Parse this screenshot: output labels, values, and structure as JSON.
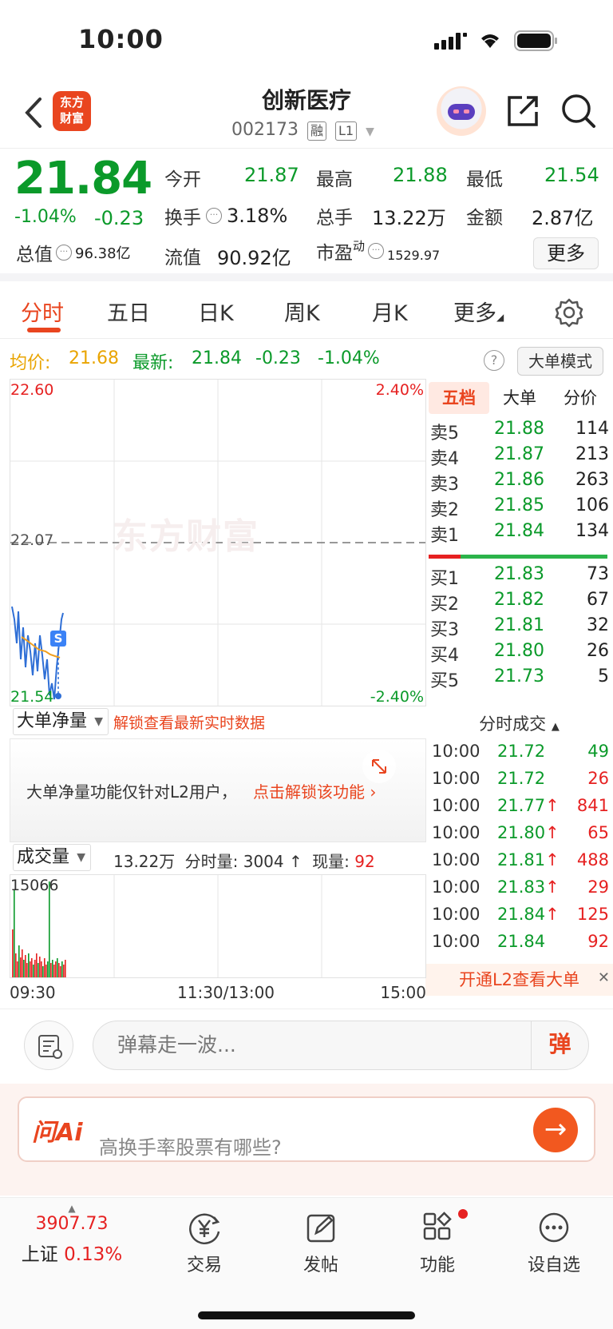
{
  "status": {
    "time": "10:00"
  },
  "header": {
    "title": "创新医疗",
    "code": "002173",
    "tag_margin": "融",
    "tag_level": "L1",
    "logo_line1": "东方",
    "logo_line2": "财富"
  },
  "quote": {
    "price": "21.84",
    "change_pct": "-1.04%",
    "change": "-0.23",
    "open_label": "今开",
    "open": "21.87",
    "high_label": "最高",
    "high": "21.88",
    "low_label": "最低",
    "low": "21.54",
    "turnover_label": "换手",
    "turnover": "3.18%",
    "volume_label": "总手",
    "volume": "13.22万",
    "amount_label": "金额",
    "amount": "2.87亿",
    "mktcap_label": "总值",
    "mktcap": "96.38亿",
    "float_label": "流值",
    "float": "90.92亿",
    "pe_label": "市盈",
    "pe_sup": "动",
    "pe": "1529.97",
    "more": "更多"
  },
  "tabs": [
    "分时",
    "五日",
    "日K",
    "周K",
    "月K",
    "更多"
  ],
  "infobar": {
    "avg_label": "均价:",
    "avg": "21.68",
    "last_label": "最新:",
    "last": "21.84",
    "chg": "-0.23",
    "chg_pct": "-1.04%",
    "mode": "大单模式"
  },
  "chart": {
    "y_top": "22.60",
    "y_mid": "22.07",
    "y_bot": "21.54",
    "pct_top": "2.40%",
    "pct_bot": "-2.40%",
    "watermark": "东方财富",
    "marker": "S"
  },
  "book": {
    "tabs": [
      "五档",
      "大单",
      "分价"
    ],
    "sells": [
      {
        "label": "卖5",
        "price": "21.88",
        "qty": "114"
      },
      {
        "label": "卖4",
        "price": "21.87",
        "qty": "213"
      },
      {
        "label": "卖3",
        "price": "21.86",
        "qty": "263"
      },
      {
        "label": "卖2",
        "price": "21.85",
        "qty": "106"
      },
      {
        "label": "卖1",
        "price": "21.84",
        "qty": "134"
      }
    ],
    "buys": [
      {
        "label": "买1",
        "price": "21.83",
        "qty": "73"
      },
      {
        "label": "买2",
        "price": "21.82",
        "qty": "67"
      },
      {
        "label": "买3",
        "price": "21.81",
        "qty": "32"
      },
      {
        "label": "买4",
        "price": "21.80",
        "qty": "26"
      },
      {
        "label": "买5",
        "price": "21.73",
        "qty": "5"
      }
    ]
  },
  "l2": {
    "select": "大单净量",
    "unlock_hint": "解锁查看最新实时数据",
    "msg": "大单净量功能仅针对L2用户，",
    "link": "点击解锁该功能"
  },
  "trades": {
    "title": "分时成交",
    "rows": [
      {
        "time": "10:00",
        "price": "21.72",
        "arrow": "",
        "vol": "49",
        "vcolor": "green"
      },
      {
        "time": "10:00",
        "price": "21.72",
        "arrow": "",
        "vol": "26",
        "vcolor": "red"
      },
      {
        "time": "10:00",
        "price": "21.77",
        "arrow": "↑",
        "vol": "841",
        "vcolor": "red"
      },
      {
        "time": "10:00",
        "price": "21.80",
        "arrow": "↑",
        "vol": "65",
        "vcolor": "red"
      },
      {
        "time": "10:00",
        "price": "21.81",
        "arrow": "↑",
        "vol": "488",
        "vcolor": "red"
      },
      {
        "time": "10:00",
        "price": "21.83",
        "arrow": "↑",
        "vol": "29",
        "vcolor": "red"
      },
      {
        "time": "10:00",
        "price": "21.84",
        "arrow": "↑",
        "vol": "125",
        "vcolor": "red"
      },
      {
        "time": "10:00",
        "price": "21.84",
        "arrow": "",
        "vol": "92",
        "vcolor": "red"
      }
    ],
    "banner": "开通L2查看大单"
  },
  "volume": {
    "select": "成交量",
    "total": "13.22万",
    "min_label": "分时量:",
    "min_val": "3004",
    "arrow": "↑",
    "cur_label": "现量:",
    "cur_val": "92",
    "y_max": "15066"
  },
  "timeaxis": {
    "start": "09:30",
    "mid": "11:30/13:00",
    "end": "15:00"
  },
  "danmu": {
    "placeholder": "弹幕走一波...",
    "button": "弹"
  },
  "ai": {
    "logo": "问Ai",
    "question": "高换手率股票有哪些?"
  },
  "nav": {
    "index_value": "3907.73",
    "index_name": "上证",
    "index_pct": "0.13%",
    "items": [
      "交易",
      "发帖",
      "功能",
      "设自选"
    ]
  },
  "colors": {
    "accent": "#e9451f",
    "up": "#e62121",
    "down": "#0b9a2a"
  }
}
